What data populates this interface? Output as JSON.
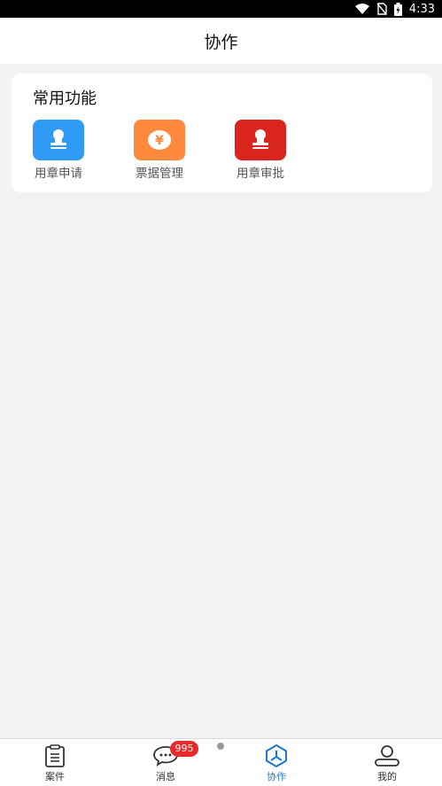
{
  "status_bar": {
    "time": "4:33",
    "icons": [
      "wifi-icon",
      "no-sim-icon",
      "battery-charging-icon"
    ]
  },
  "header": {
    "title": "协作"
  },
  "common_functions": {
    "title": "常用功能",
    "items": [
      {
        "label": "用章申请",
        "icon": "stamp-icon",
        "color": "#2f9bf5"
      },
      {
        "label": "票据管理",
        "icon": "yen-icon",
        "color": "#ff8a3d"
      },
      {
        "label": "用章审批",
        "icon": "stamp-icon",
        "color": "#d9251d"
      }
    ]
  },
  "bottom_nav": {
    "items": [
      {
        "label": "案件",
        "icon": "clipboard-icon",
        "active": false
      },
      {
        "label": "消息",
        "icon": "chat-bubble-icon",
        "active": false
      },
      {
        "label": "协作",
        "icon": "collaboration-icon",
        "active": true
      },
      {
        "label": "我的",
        "icon": "profile-icon",
        "active": false
      }
    ],
    "message_badge": "995",
    "accent_color": "#1b78d0"
  }
}
